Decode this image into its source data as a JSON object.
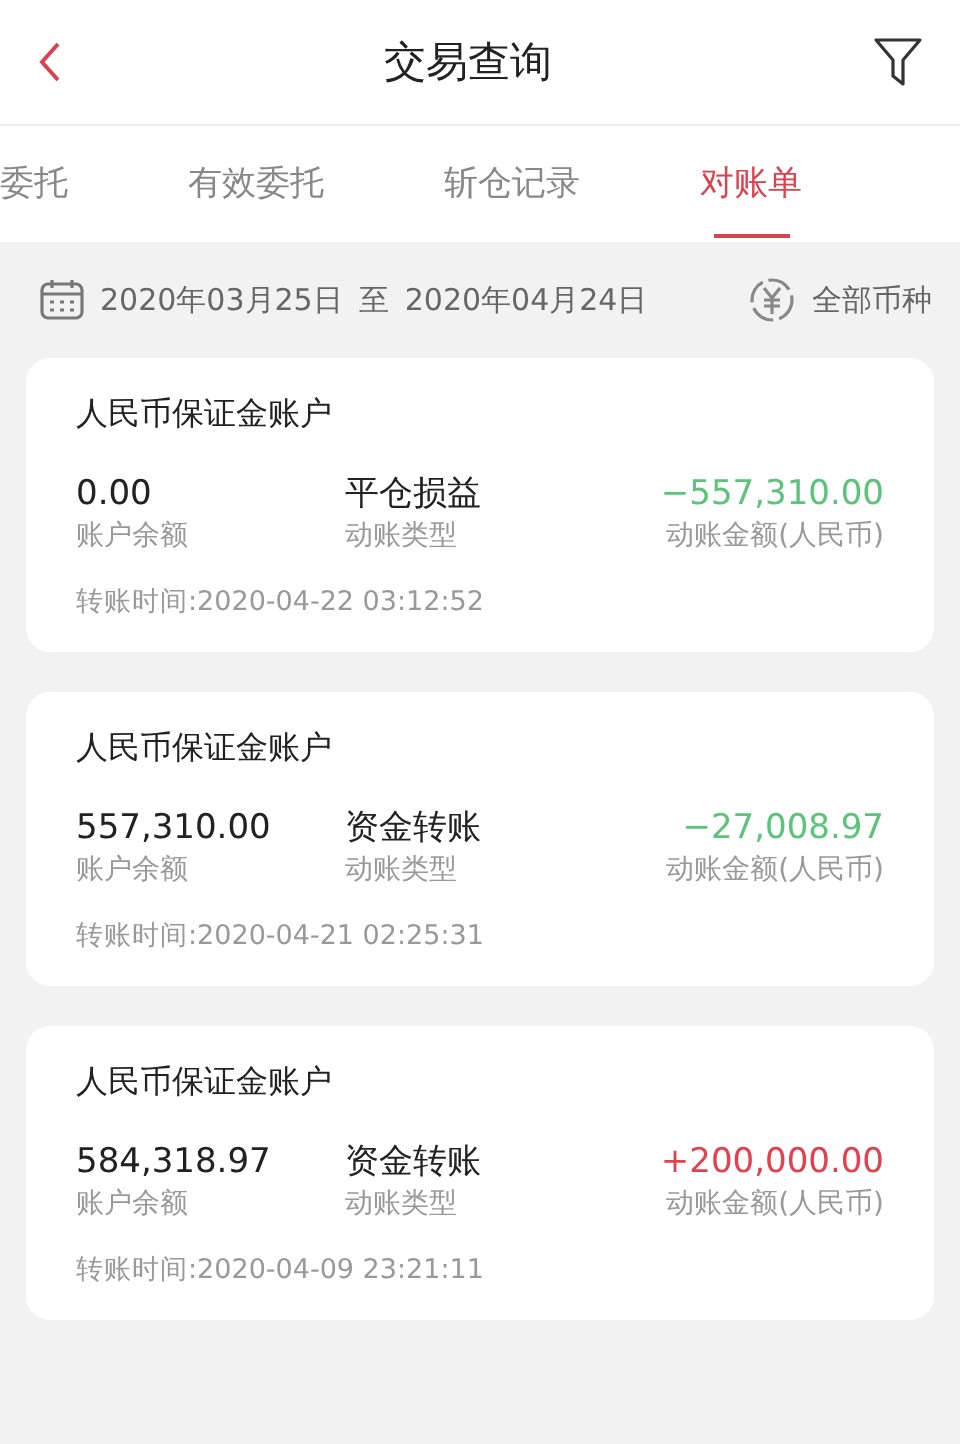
{
  "header": {
    "title": "交易查询"
  },
  "tabs": [
    {
      "label": "委托",
      "selected": false
    },
    {
      "label": "有效委托",
      "selected": false
    },
    {
      "label": "斩仓记录",
      "selected": false
    },
    {
      "label": "对账单",
      "selected": true
    }
  ],
  "filter": {
    "start_date": "2020年03月25日",
    "separator": "至",
    "end_date": "2020年04月24日",
    "currency": "全部币种"
  },
  "records": [
    {
      "account": "人民币保证金账户",
      "balance": "0.00",
      "balance_label": "账户余额",
      "type": "平仓损益",
      "type_label": "动账类型",
      "amount": "−557,310.00",
      "color": "#5cc47a",
      "amount_label": "动账金额(人民币)",
      "time": "转账时间:2020-04-22 03:12:52"
    },
    {
      "account": "人民币保证金账户",
      "balance": "557,310.00",
      "balance_label": "账户余额",
      "type": "资金转账",
      "type_label": "动账类型",
      "amount": "−27,008.97",
      "color": "#5cc47a",
      "amount_label": "动账金额(人民币)",
      "time": "转账时间:2020-04-21 02:25:31"
    },
    {
      "account": "人民币保证金账户",
      "balance": "584,318.97",
      "balance_label": "账户余额",
      "type": "资金转账",
      "type_label": "动账类型",
      "amount": "+200,000.00",
      "color": "#e0434f",
      "amount_label": "动账金额(人民币)",
      "time": "转账时间:2020-04-09 23:21:11"
    }
  ]
}
